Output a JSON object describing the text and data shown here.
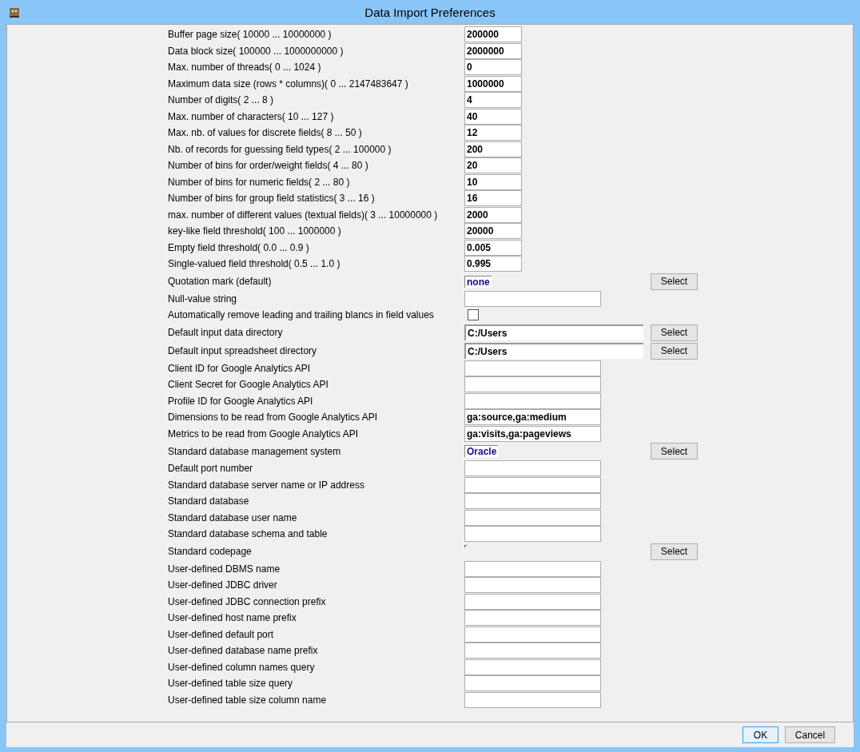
{
  "window": {
    "title": "Data Import Preferences"
  },
  "rows": [
    {
      "kind": "short",
      "label": "Buffer page size( 10000 ... 10000000 )",
      "value": "200000"
    },
    {
      "kind": "short",
      "label": "Data block size( 100000 ... 1000000000 )",
      "value": "2000000"
    },
    {
      "kind": "short",
      "label": "Max. number of threads( 0 ... 1024 )",
      "value": "0"
    },
    {
      "kind": "short",
      "label": "Maximum data size (rows * columns)( 0 ... 2147483647 )",
      "value": "1000000"
    },
    {
      "kind": "short",
      "label": "Number of digits( 2 ... 8 )",
      "value": "4"
    },
    {
      "kind": "short",
      "label": "Max. number of characters( 10 ... 127 )",
      "value": "40"
    },
    {
      "kind": "short",
      "label": "Max. nb. of values for discrete fields( 8 ... 50 )",
      "value": "12"
    },
    {
      "kind": "short",
      "label": "Nb. of records for guessing field types( 2 ... 100000 )",
      "value": "200"
    },
    {
      "kind": "short",
      "label": "Number of bins for order/weight fields( 4 ... 80 )",
      "value": "20"
    },
    {
      "kind": "short",
      "label": "Number of bins for numeric fields( 2 ... 80 )",
      "value": "10"
    },
    {
      "kind": "short",
      "label": "Number of bins for group field statistics( 3 ... 16 )",
      "value": "16"
    },
    {
      "kind": "short",
      "label": "max. number of different values (textual fields)( 3 ... 10000000 )",
      "value": "2000"
    },
    {
      "kind": "short",
      "label": "key-like field threshold( 100 ... 1000000 )",
      "value": "20000"
    },
    {
      "kind": "short",
      "label": "Empty field threshold( 0.0 ... 0.9 )",
      "value": "0.005"
    },
    {
      "kind": "short",
      "label": "Single-valued field threshold( 0.5 ... 1.0 )",
      "value": "0.995"
    },
    {
      "kind": "choice",
      "label": "Quotation mark (default)",
      "value": "none",
      "button": "Select"
    },
    {
      "kind": "long",
      "label": "Null-value string"
    },
    {
      "kind": "checkbox",
      "label": "Automatically remove leading and trailing blancs in field values",
      "checked": false
    },
    {
      "kind": "path",
      "label": "Default input data directory",
      "value": "C:/Users",
      "button": "Select"
    },
    {
      "kind": "path",
      "label": "Default input spreadsheet directory",
      "value": "C:/Users",
      "button": "Select"
    },
    {
      "kind": "long",
      "label": "Client ID for Google Analytics API"
    },
    {
      "kind": "long",
      "label": "Client Secret for Google Analytics API"
    },
    {
      "kind": "long",
      "label": "Profile ID for Google Analytics API"
    },
    {
      "kind": "long",
      "label": "Dimensions to be read from Google Analytics API",
      "value": "ga:source,ga:medium"
    },
    {
      "kind": "long",
      "label": "Metrics to be read from Google Analytics API",
      "value": "ga:visits,ga:pageviews"
    },
    {
      "kind": "choice",
      "label": "Standard database management system",
      "value": "Oracle",
      "button": "Select"
    },
    {
      "kind": "long",
      "label": "Default port number"
    },
    {
      "kind": "long",
      "label": "Standard database server name or IP address"
    },
    {
      "kind": "long",
      "label": "Standard database"
    },
    {
      "kind": "long",
      "label": "Standard database user name"
    },
    {
      "kind": "long",
      "label": "Standard database schema and table"
    },
    {
      "kind": "choice",
      "label": "Standard codepage",
      "button": "Select"
    },
    {
      "kind": "long",
      "label": "User-defined DBMS name"
    },
    {
      "kind": "long",
      "label": "User-defined JDBC driver"
    },
    {
      "kind": "long",
      "label": "User-defined JDBC connection prefix"
    },
    {
      "kind": "long",
      "label": "User-defined host name prefix"
    },
    {
      "kind": "long",
      "label": "User-defined default port"
    },
    {
      "kind": "long",
      "label": "User-defined database name prefix"
    },
    {
      "kind": "long",
      "label": "User-defined column names query"
    },
    {
      "kind": "long",
      "label": "User-defined table size query"
    },
    {
      "kind": "long",
      "label": "User-defined table size column name"
    }
  ],
  "buttons": [
    {
      "label": "OK",
      "selected": true
    },
    {
      "label": "Cancel",
      "selected": false
    }
  ]
}
